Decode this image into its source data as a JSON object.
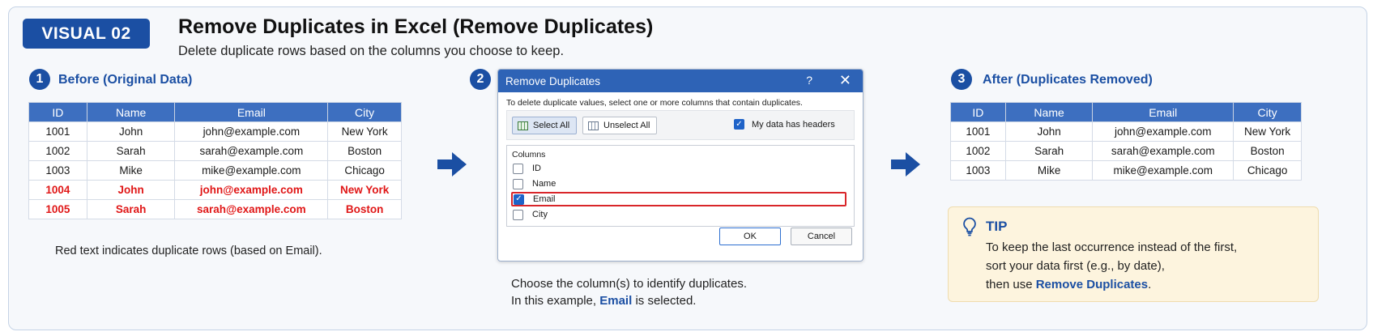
{
  "header": {
    "badge": "VISUAL 02",
    "title": "Remove Duplicates in Excel (Remove Duplicates)",
    "subtitle": "Delete duplicate rows based on the columns you choose to keep."
  },
  "step1": {
    "number": "1",
    "title": "Before (Original Data)",
    "columns": [
      "ID",
      "Name",
      "Email",
      "City"
    ],
    "rows": [
      {
        "cells": [
          "1001",
          "John",
          "john@example.com",
          "New York"
        ],
        "duplicate": false
      },
      {
        "cells": [
          "1002",
          "Sarah",
          "sarah@example.com",
          "Boston"
        ],
        "duplicate": false
      },
      {
        "cells": [
          "1003",
          "Mike",
          "mike@example.com",
          "Chicago"
        ],
        "duplicate": false
      },
      {
        "cells": [
          "1004",
          "John",
          "john@example.com",
          "New York"
        ],
        "duplicate": true
      },
      {
        "cells": [
          "1005",
          "Sarah",
          "sarah@example.com",
          "Boston"
        ],
        "duplicate": true
      }
    ],
    "note": "Red text indicates duplicate rows (based on Email)."
  },
  "step2": {
    "number": "2",
    "dialog": {
      "title": "Remove Duplicates",
      "help": "?",
      "close": "✕",
      "description": "To delete duplicate values, select one or more columns that contain duplicates.",
      "select_all": "Select All",
      "unselect_all": "Unselect All",
      "headers_label": "My data has headers",
      "headers_checked": true,
      "columns_label": "Columns",
      "columns": [
        {
          "label": "ID",
          "checked": false
        },
        {
          "label": "Name",
          "checked": false
        },
        {
          "label": "Email",
          "checked": true
        },
        {
          "label": "City",
          "checked": false
        }
      ],
      "ok": "OK",
      "cancel": "Cancel"
    },
    "caption_line1": "Choose the column(s) to identify duplicates.",
    "caption_line2_prefix": "In this example,",
    "caption_line2_bold": "Email",
    "caption_line2_suffix": "is selected."
  },
  "step3": {
    "number": "3",
    "title": "After (Duplicates Removed)",
    "columns": [
      "ID",
      "Name",
      "Email",
      "City"
    ],
    "rows": [
      [
        "1001",
        "John",
        "john@example.com",
        "New York"
      ],
      [
        "1002",
        "Sarah",
        "sarah@example.com",
        "Boston"
      ],
      [
        "1003",
        "Mike",
        "mike@example.com",
        "Chicago"
      ]
    ]
  },
  "tip": {
    "title": "TIP",
    "line1": "To keep the last occurrence instead of the first,",
    "line2": "sort your data first (e.g., by date),",
    "line3_prefix": "then use",
    "line3_bold": "Remove Duplicates",
    "line3_suffix": "."
  },
  "colors": {
    "accent": "#1b4fa3",
    "table_header": "#3d6fc0",
    "duplicate_text": "#e01717",
    "tip_background": "#fdf4de"
  },
  "icons": [
    "arrow-right-icon",
    "lightbulb-icon",
    "select-all-icon",
    "unselect-all-icon",
    "checkbox-icon"
  ]
}
